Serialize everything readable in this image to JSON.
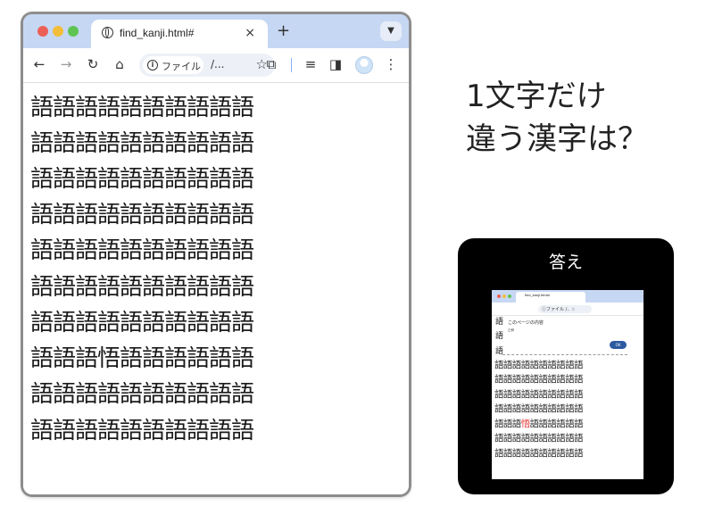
{
  "browser": {
    "tab_title": "find_kanji.html#",
    "tab_close": "×",
    "new_tab": "+",
    "address_chip_label": "ファイル",
    "address_text": "/...",
    "icons": {
      "close_button_color": "#ec5f57",
      "minimize_button_color": "#f3bd3a",
      "zoom_button_color": "#5fc453",
      "tab_bar_color": "#c6d7f3"
    }
  },
  "content": {
    "rows": [
      "語語語語語語語語語語",
      "語語語語語語語語語語",
      "語語語語語語語語語語",
      "語語語語語語語語語語",
      "語語語語語語語語語語",
      "語語語語語語語語語語",
      "語語語語語語語語語語",
      "語語語悟語語語語語語",
      "語語語語語語語語語語",
      "語語語語語語語語語語"
    ]
  },
  "question": {
    "line1": "1文字だけ",
    "line2": "違う漢字は？"
  },
  "answer": {
    "title": "答え",
    "mini_tab_title": "find_kanji.html#",
    "mini_address": "ⓘファイル /.. ☆",
    "dialog_kanji": [
      "語",
      "語",
      "語"
    ],
    "dialog_title": "このページの内容",
    "dialog_sub": "正解",
    "ok_label": "OK",
    "rows_before": [
      "語語語語語語語語語語",
      "語語語語語語語語語語",
      "語語語語語語語語語語",
      "語語語語語語語語語語"
    ],
    "highlight_row": {
      "prefix": "語語語",
      "odd": "悟",
      "suffix": "語語語語語語"
    },
    "rows_after": [
      "語語語語語語語語語語",
      "語語語語語語語語語語"
    ],
    "highlight_color": "#e53935"
  }
}
